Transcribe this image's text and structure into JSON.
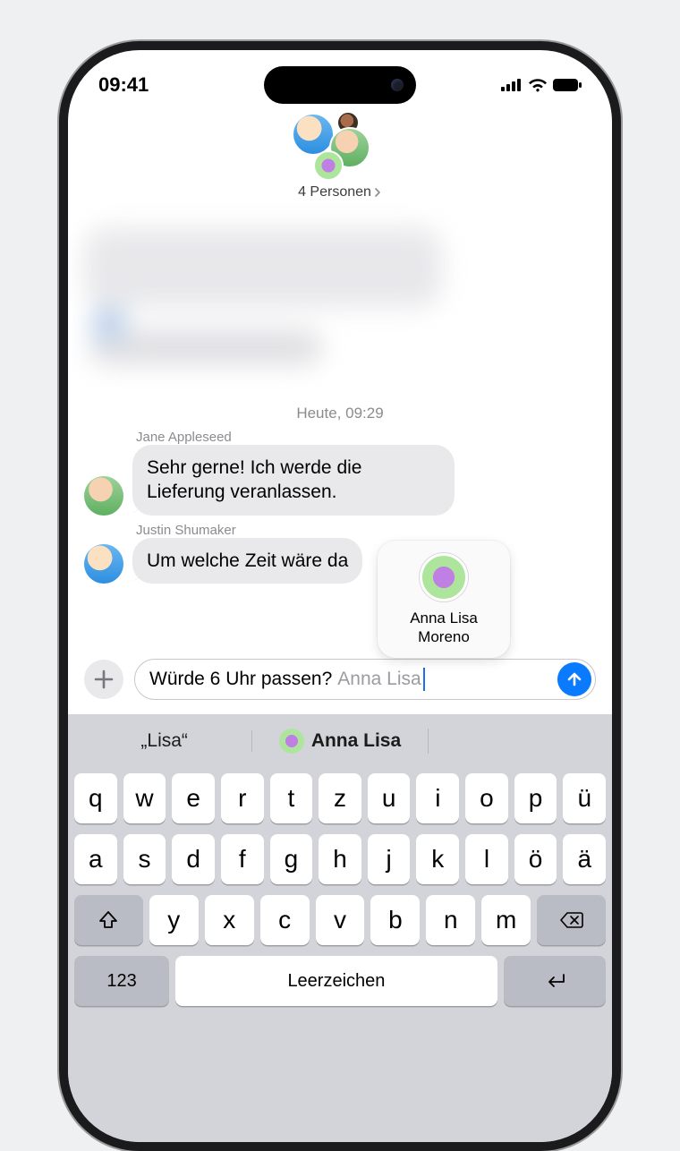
{
  "status": {
    "time": "09:41"
  },
  "header": {
    "group_label": "4 Personen"
  },
  "thread": {
    "timestamp": "Heute, 09:29",
    "messages": [
      {
        "sender": "Jane Appleseed",
        "text": "Sehr gerne! Ich werde die Lieferung veranlassen."
      },
      {
        "sender": "Justin Shumaker",
        "text": "Um welche Zeit wäre da"
      }
    ]
  },
  "compose": {
    "typed": "Würde 6 Uhr passen?",
    "mention": "Anna Lisa"
  },
  "mention_popover": {
    "name_line1": "Anna Lisa",
    "name_line2": "Moreno"
  },
  "predictions": {
    "p1": "„Lisa“",
    "p2": "Anna Lisa",
    "p3": ""
  },
  "keyboard": {
    "row1": [
      "q",
      "w",
      "e",
      "r",
      "t",
      "z",
      "u",
      "i",
      "o",
      "p",
      "ü"
    ],
    "row2": [
      "a",
      "s",
      "d",
      "f",
      "g",
      "h",
      "j",
      "k",
      "l",
      "ö",
      "ä"
    ],
    "row3": [
      "y",
      "x",
      "c",
      "v",
      "b",
      "n",
      "m"
    ],
    "numbers": "123",
    "space": "Leerzeichen"
  }
}
